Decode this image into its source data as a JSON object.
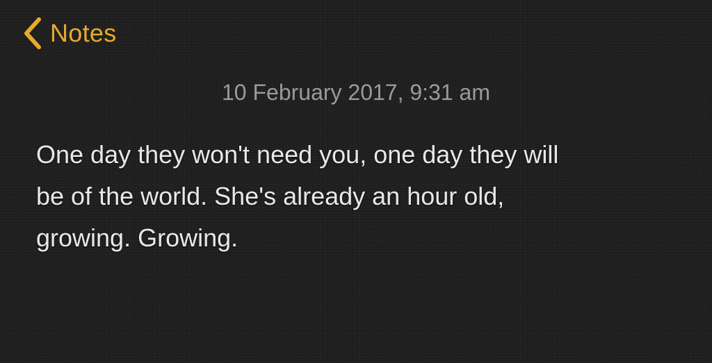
{
  "nav": {
    "back_label": "Notes",
    "back_icon": "chevron-left-icon",
    "accent_color": "#e7aa2d"
  },
  "note": {
    "timestamp": "10 February 2017, 9:31 am",
    "lines": [
      "One day they won't need you, one day they will",
      "be of the world. She's already an hour old,",
      "growing. Growing."
    ]
  }
}
